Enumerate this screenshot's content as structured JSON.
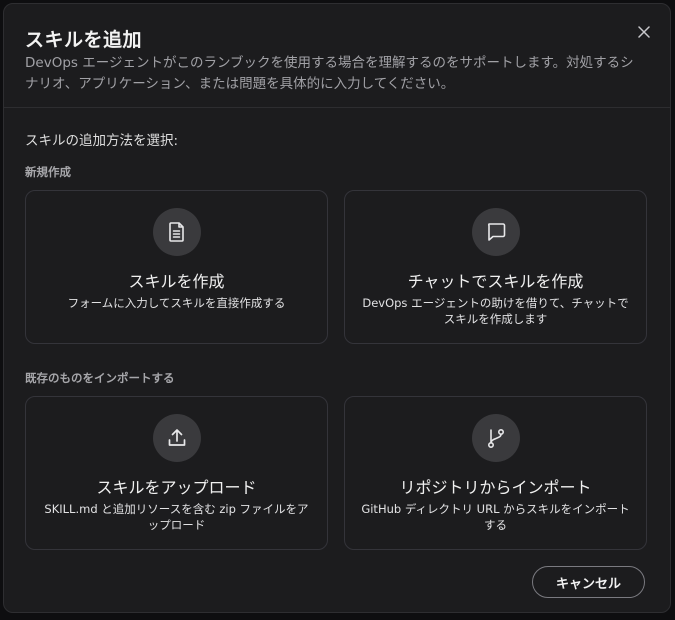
{
  "dialog": {
    "title": "スキルを追加",
    "description": "DevOps エージェントがこのランブックを使用する場合を理解するのをサポートします。対処するシナリオ、アプリケーション、または問題を具体的に入力してください。",
    "close_icon": "close-icon",
    "prompt": "スキルの追加方法を選択:",
    "sections": [
      {
        "label": "新規作成",
        "cards": [
          {
            "icon": "document-icon",
            "title": "スキルを作成",
            "description": "フォームに入力してスキルを直接作成する"
          },
          {
            "icon": "chat-icon",
            "title": "チャットでスキルを作成",
            "description": "DevOps エージェントの助けを借りて、チャットでスキルを作成します"
          }
        ]
      },
      {
        "label": "既存のものをインポートする",
        "cards": [
          {
            "icon": "upload-icon",
            "title": "スキルをアップロード",
            "description": "SKILL.md と追加リソースを含む zip ファイルをアップロード"
          },
          {
            "icon": "git-branch-icon",
            "title": "リポジトリからインポート",
            "description": "GitHub ディレクトリ URL からスキルをインポートする"
          }
        ]
      }
    ],
    "cancel_label": "キャンセル"
  },
  "colors": {
    "dialog_bg": "#1c1c1e",
    "card_border": "#34343a",
    "icon_circle": "#3a3a3d",
    "muted_text": "#a1a1a6"
  }
}
